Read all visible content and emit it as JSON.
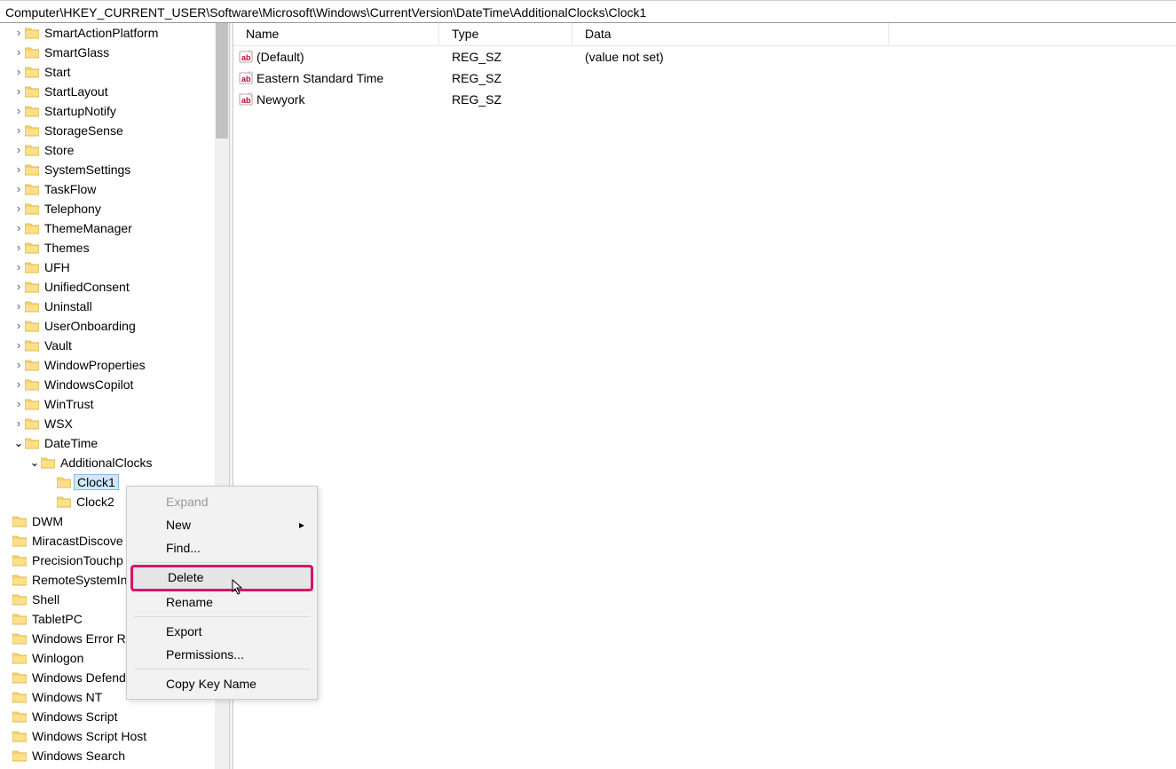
{
  "address_bar": "Computer\\HKEY_CURRENT_USER\\Software\\Microsoft\\Windows\\CurrentVersion\\DateTime\\AdditionalClocks\\Clock1",
  "columns": {
    "name": "Name",
    "type": "Type",
    "data": "Data"
  },
  "values": [
    {
      "name": "(Default)",
      "type": "REG_SZ",
      "data": "(value not set)"
    },
    {
      "name": "Eastern Standard Time",
      "type": "REG_SZ",
      "data": ""
    },
    {
      "name": "Newyork",
      "type": "REG_SZ",
      "data": ""
    }
  ],
  "tree": {
    "g1": [
      "SmartActionPlatform",
      "SmartGlass",
      "Start",
      "StartLayout",
      "StartupNotify",
      "StorageSense",
      "Store",
      "SystemSettings",
      "TaskFlow",
      "Telephony",
      "ThemeManager",
      "Themes",
      "UFH",
      "UnifiedConsent",
      "Uninstall",
      "UserOnboarding",
      "Vault",
      "WindowProperties",
      "WindowsCopilot",
      "WinTrust",
      "WSX"
    ],
    "datetime": "DateTime",
    "additional_clocks": "AdditionalClocks",
    "clock1": "Clock1",
    "clock2": "Clock2",
    "g2": [
      "DWM",
      "MiracastDiscove",
      "PrecisionTouchp",
      "RemoteSystemIn",
      "Shell",
      "TabletPC",
      "Windows Error R",
      "Winlogon"
    ],
    "g3": [
      "Windows Defender",
      "Windows NT",
      "Windows Script",
      "Windows Script Host",
      "Windows Search"
    ]
  },
  "context_menu": {
    "expand": "Expand",
    "new": "New",
    "find": "Find...",
    "delete": "Delete",
    "rename": "Rename",
    "export": "Export",
    "permissions": "Permissions...",
    "copy_key_name": "Copy Key Name"
  }
}
